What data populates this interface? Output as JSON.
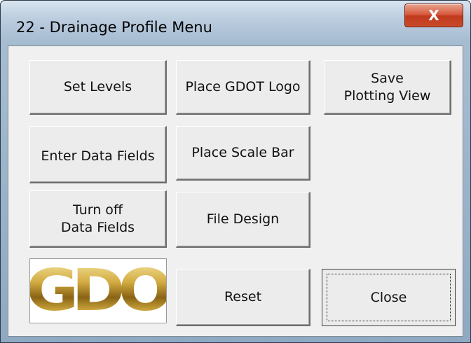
{
  "window": {
    "title": "22 - Drainage Profile Menu",
    "close_glyph": "X"
  },
  "buttons": {
    "set_levels": "Set Levels",
    "place_gdot_logo": "Place GDOT Logo",
    "save_plotting_view": "Save\nPlotting View",
    "enter_data_fields": "Enter Data Fields",
    "place_scale_bar": "Place Scale Bar",
    "turn_off_data_fields": "Turn off\nData Fields",
    "file_design": "File Design",
    "reset": "Reset",
    "close": "Close"
  },
  "logo": {
    "text": "GDOT",
    "color": "#c8a23a"
  },
  "colors": {
    "close_button_red": "#c94a2a",
    "dialog_background": "#f0f0f0",
    "title_bar": "#bccddf"
  }
}
